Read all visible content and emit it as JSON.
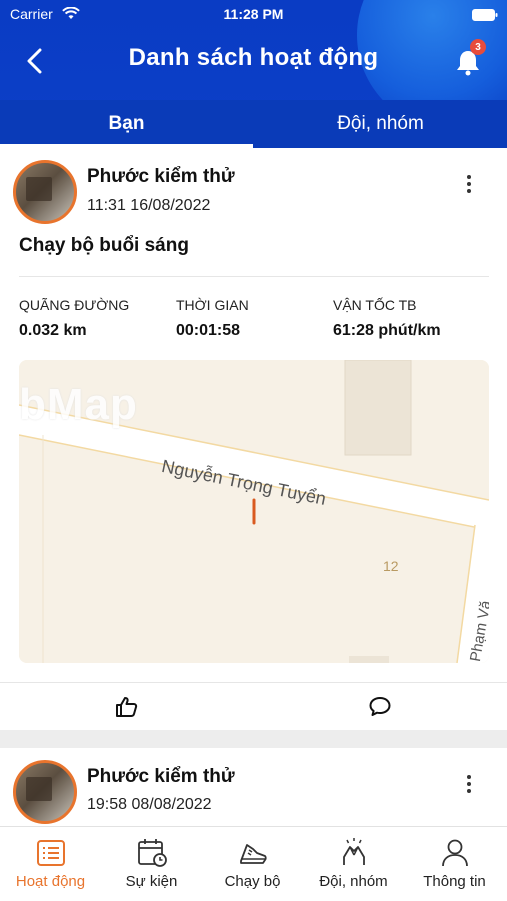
{
  "status_bar": {
    "carrier": "Carrier",
    "time": "11:28 PM"
  },
  "header": {
    "title": "Danh sách hoạt động",
    "notification_count": "3"
  },
  "tabs": [
    {
      "label": "Bạn",
      "active": true
    },
    {
      "label": "Đội, nhóm",
      "active": false
    }
  ],
  "posts": [
    {
      "user_name": "Phước kiểm thử",
      "timestamp": "11:31 16/08/2022",
      "activity_title": "Chạy bộ buổi sáng",
      "stats": [
        {
          "label": "QUÃNG ĐƯỜNG",
          "value": "0.032 km"
        },
        {
          "label": "THỜI GIAN",
          "value": "00:01:58"
        },
        {
          "label": "VẬN TỐC TB",
          "value": "61:28 phút/km"
        }
      ],
      "map": {
        "watermark": "bMap",
        "street": "Nguyễn Trọng Tuyển",
        "house_number": "12",
        "side_street": "Phạm Vă"
      }
    },
    {
      "user_name": "Phước kiểm thử",
      "timestamp": "19:58 08/08/2022"
    }
  ],
  "bottom_nav": [
    {
      "label": "Hoạt động",
      "icon": "activity-list-icon",
      "active": true
    },
    {
      "label": "Sự kiện",
      "icon": "calendar-icon",
      "active": false
    },
    {
      "label": "Chạy bộ",
      "icon": "running-shoe-icon",
      "active": false
    },
    {
      "label": "Đội, nhóm",
      "icon": "team-hands-icon",
      "active": false
    },
    {
      "label": "Thông tin",
      "icon": "profile-icon",
      "active": false
    }
  ],
  "colors": {
    "header_blue": "#0a3cc4",
    "accent_orange": "#e8742d",
    "badge_red": "#e74c3c"
  }
}
